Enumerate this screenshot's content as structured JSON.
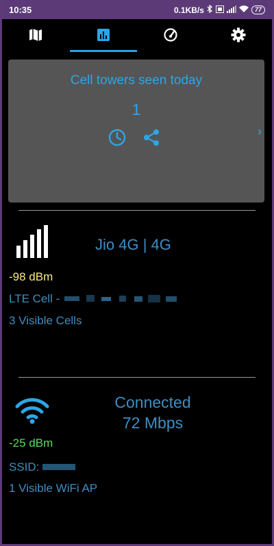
{
  "status_bar": {
    "time": "10:35",
    "network_speed": "0.1KB/s",
    "battery": "77"
  },
  "tabs": [
    {
      "icon": "map-icon",
      "active": false
    },
    {
      "icon": "chart-icon",
      "active": true
    },
    {
      "icon": "speedometer-icon",
      "active": false
    },
    {
      "icon": "gear-icon",
      "active": false
    }
  ],
  "towers_card": {
    "title": "Cell towers seen today",
    "count": "1",
    "icons": [
      "history-icon",
      "share-icon"
    ],
    "chevron": "›"
  },
  "cell": {
    "operator": "Jio 4G | 4G",
    "signal": "-98 dBm",
    "cell_label": "LTE Cell -",
    "visible_cells": "3 Visible Cells"
  },
  "wifi": {
    "status": "Connected",
    "speed": "72 Mbps",
    "signal": "-25 dBm",
    "ssid_label": "SSID:",
    "visible_aps": "1 Visible WiFi AP"
  },
  "colors": {
    "accent": "#2ca6e6",
    "text_blue": "#3d8ec3",
    "weak_signal": "#ffe87a",
    "strong_signal": "#5ddc5a",
    "status_bar": "#5c3a78"
  }
}
